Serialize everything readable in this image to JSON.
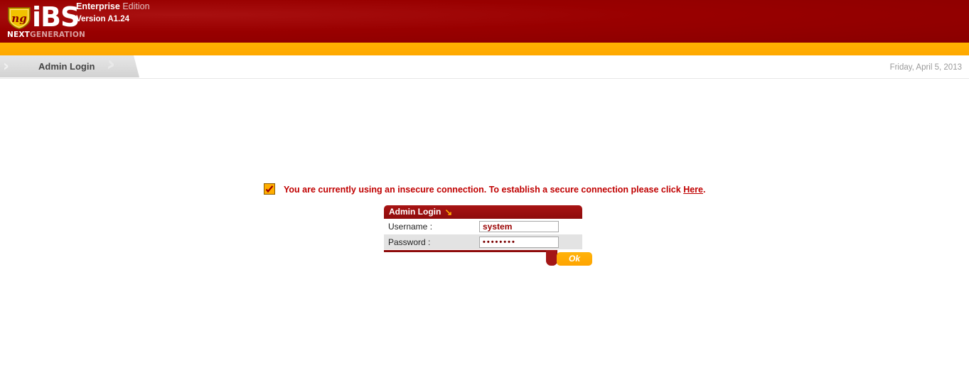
{
  "header": {
    "logo": {
      "shield_mark": "ng",
      "brand": "iBS",
      "tagline_bold": "NEXT",
      "tagline_light": "GENERATION"
    },
    "edition_strong": "Enterprise",
    "edition_light": " Edition",
    "version": "Version A1.24"
  },
  "breadcrumb": {
    "chevron": "›",
    "watermark": "›",
    "label": "Admin Login",
    "date": "Friday, April 5, 2013"
  },
  "warning": {
    "icon": "checkmark-box-icon",
    "text_before": "You are currently using an insecure connection. To establish a secure connection please click ",
    "link_label": "Here",
    "text_after": "."
  },
  "login_panel": {
    "title": "Admin Login",
    "title_arrow": "↘",
    "fields": [
      {
        "label": "Username :",
        "value": "system",
        "placeholder": "",
        "type": "text"
      },
      {
        "label": "Password :",
        "value": "••••••••",
        "placeholder": "",
        "type": "password"
      }
    ],
    "submit_label": "Ok"
  },
  "colors": {
    "header_red": "#990000",
    "accent_orange": "#ffad00",
    "panel_red": "#8e0b0b",
    "warning_red": "#c00000",
    "value_red": "#990000"
  }
}
